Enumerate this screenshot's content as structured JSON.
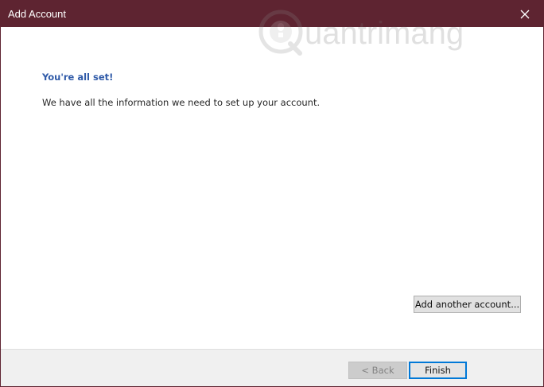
{
  "window": {
    "title": "Add Account",
    "close_icon": "close-icon"
  },
  "watermark": {
    "text": "uantrimang",
    "logo_letter": "Q"
  },
  "content": {
    "heading": "You're all set!",
    "message": "We have all the information we need to set up your account.",
    "add_another_label": "Add another account..."
  },
  "footer": {
    "back_label": "< Back",
    "finish_label": "Finish"
  },
  "colors": {
    "titlebar": "#5e2431",
    "heading": "#2f5aa8",
    "focus": "#0078d7"
  }
}
